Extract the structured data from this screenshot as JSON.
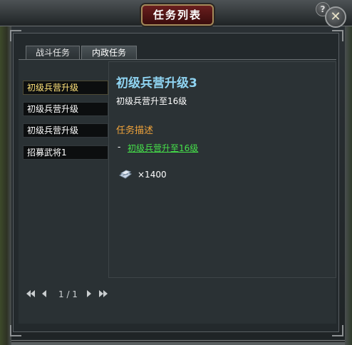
{
  "window": {
    "title": "任务列表",
    "help_label": "?",
    "close_label": "✕"
  },
  "tabs": [
    {
      "label": "战斗任务",
      "active": false
    },
    {
      "label": "内政任务",
      "active": true
    }
  ],
  "quest_list": [
    {
      "label": "初级兵营升级",
      "selected": true
    },
    {
      "label": "初级兵营升级",
      "selected": false
    },
    {
      "label": "初级兵营升级",
      "selected": false
    },
    {
      "label": "招募武将1",
      "selected": false
    }
  ],
  "detail": {
    "title": "初级兵营升级3",
    "subtitle": "初级兵营升至16级",
    "section_title": "任务描述",
    "bullet": "-",
    "objective_link": "初级兵营升至16级",
    "reward_icon": "silver-ingot-icon",
    "reward_value": "×1400"
  },
  "pager": {
    "text": "1 / 1"
  },
  "colors": {
    "title_color": "#8fd4f2",
    "section_color": "#f0a33a",
    "link_color": "#46e14a",
    "selected_color": "#ffe37a"
  }
}
